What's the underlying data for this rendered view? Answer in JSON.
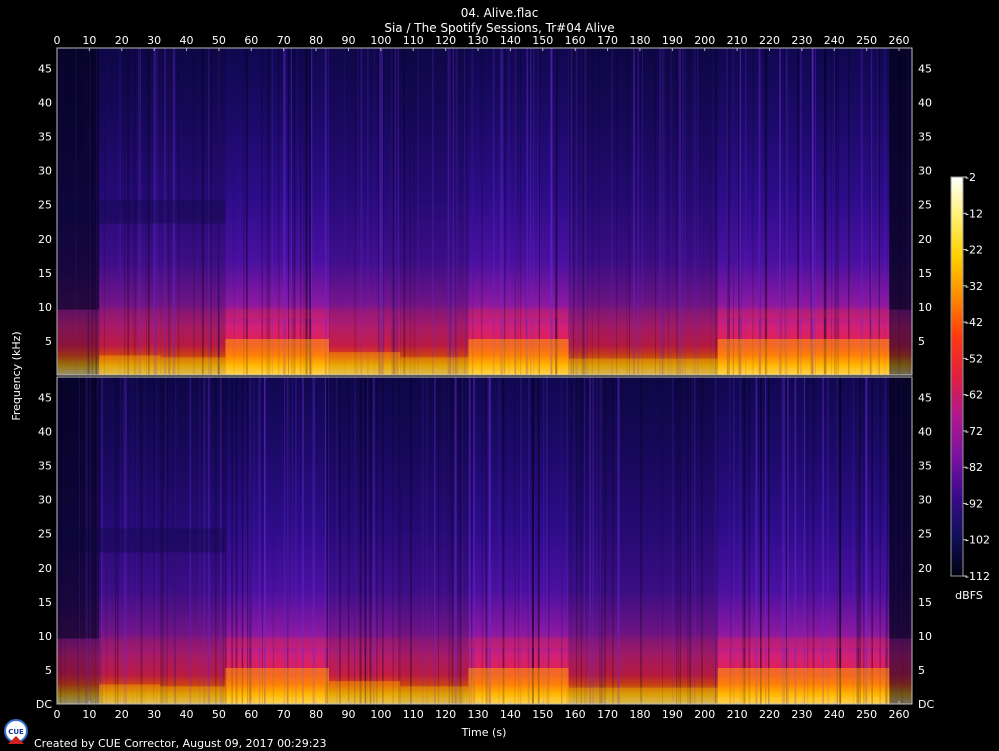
{
  "title": "04. Alive.flac",
  "subtitle": "Sia / The Spotify Sessions, Tr#04 Alive",
  "footer": "Created by CUE Corrector, August 09, 2017 00:29:23",
  "logo_text": "CUE",
  "chart_data": {
    "type": "heatmap",
    "xlabel": "Time (s)",
    "ylabel": "Frequency (kHz)",
    "x_ticks": [
      "0",
      "10",
      "20",
      "30",
      "40",
      "50",
      "60",
      "70",
      "80",
      "90",
      "100",
      "110",
      "120",
      "130",
      "140",
      "150",
      "160",
      "170",
      "180",
      "190",
      "200",
      "210",
      "220",
      "230",
      "240",
      "250",
      "260"
    ],
    "y_ticks_top": [
      "5",
      "10",
      "15",
      "20",
      "25",
      "30",
      "35",
      "40",
      "45"
    ],
    "y_ticks_bottom": [
      "DC",
      "5",
      "10",
      "15",
      "20",
      "25",
      "30",
      "35",
      "40",
      "45"
    ],
    "xlim": [
      0,
      264
    ],
    "ylim_khz": [
      0,
      48
    ],
    "channels": 2,
    "colorbar": {
      "unit": "dBFS",
      "ticks": [
        "-2",
        "-12",
        "-22",
        "-32",
        "-42",
        "-52",
        "-62",
        "-72",
        "-82",
        "-92",
        "-102",
        "-112"
      ],
      "range": [
        -112,
        -2
      ],
      "colors": [
        "#000012",
        "#10105a",
        "#3a0a8a",
        "#7a12a0",
        "#b01890",
        "#e02040",
        "#ff3a10",
        "#ff8a00",
        "#ffd000",
        "#fff070",
        "#ffffff"
      ]
    },
    "segments": [
      {
        "start": 0,
        "end": 13,
        "level": 0.45
      },
      {
        "start": 13,
        "end": 32,
        "level": 0.75
      },
      {
        "start": 32,
        "end": 52,
        "level": 0.72
      },
      {
        "start": 52,
        "end": 84,
        "level": 1.0
      },
      {
        "start": 84,
        "end": 106,
        "level": 0.8
      },
      {
        "start": 106,
        "end": 127,
        "level": 0.72
      },
      {
        "start": 127,
        "end": 158,
        "level": 1.0
      },
      {
        "start": 158,
        "end": 204,
        "level": 0.7
      },
      {
        "start": 204,
        "end": 257,
        "level": 1.0
      },
      {
        "start": 257,
        "end": 264,
        "level": 0.25
      }
    ]
  }
}
